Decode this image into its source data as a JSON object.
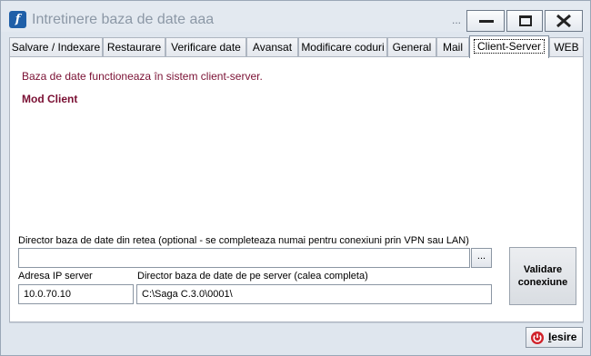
{
  "window": {
    "title": "Intretinere baza de date aaa",
    "title_ellipsis": "...",
    "icon_letter": "f"
  },
  "tabs": [
    {
      "label": "Salvare / Indexare",
      "active": false
    },
    {
      "label": "Restaurare",
      "active": false
    },
    {
      "label": "Verificare date",
      "active": false
    },
    {
      "label": "Avansat",
      "active": false
    },
    {
      "label": "Modificare coduri",
      "active": false
    },
    {
      "label": "General",
      "active": false
    },
    {
      "label": "Mail",
      "active": false
    },
    {
      "label": "Client-Server",
      "active": true
    },
    {
      "label": "WEB",
      "active": false
    }
  ],
  "panel": {
    "message": "Baza de date functioneaza în sistem client-server.",
    "mode": "Mod Client",
    "network_dir_label": "Director baza de date din retea (optional - se completeaza numai pentru conexiuni prin VPN sau LAN)",
    "network_dir_value": "",
    "browse_label": "...",
    "server_ip_label": "Adresa IP server",
    "server_ip_value": "10.0.70.10",
    "server_dir_label": "Director baza de date de pe server (calea completa)",
    "server_dir_value": "C:\\Saga C.3.0\\0001\\",
    "validate_label": "Validare conexiune"
  },
  "footer": {
    "exit_label_first": "I",
    "exit_label_rest": "esire"
  },
  "colors": {
    "accent_text": "#7a1033",
    "exit_icon": "#d0222a",
    "app_icon": "#1f5fa8"
  }
}
